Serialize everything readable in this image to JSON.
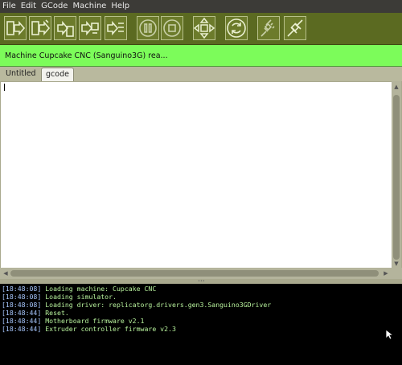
{
  "menu": {
    "items": [
      "File",
      "Edit",
      "GCode",
      "Machine",
      "Help"
    ]
  },
  "toolbar": {
    "buttons": [
      {
        "name": "build-button-icon"
      },
      {
        "name": "upload-button-icon"
      },
      {
        "name": "build-to-file-button-icon"
      },
      {
        "name": "build-remote-button-icon"
      },
      {
        "name": "generate-button-icon"
      },
      {
        "name": "pause-button-icon"
      },
      {
        "name": "stop-button-icon"
      },
      {
        "name": "control-panel-button-icon"
      },
      {
        "name": "reset-button-icon"
      },
      {
        "name": "disconnect-button-icon"
      },
      {
        "name": "connect-button-icon"
      }
    ]
  },
  "status": {
    "text": "Machine Cupcake CNC (Sanguino3G) rea..."
  },
  "tabs": [
    {
      "label": "Untitled",
      "active": false
    },
    {
      "label": "gcode",
      "active": true
    }
  ],
  "console": {
    "lines": [
      {
        "time": "[18:48:08]",
        "text": "Loading machine: Cupcake CNC"
      },
      {
        "time": "[18:48:08]",
        "text": "Loading simulator."
      },
      {
        "time": "[18:48:08]",
        "text": "Loading driver: replicatorg.drivers.gen3.Sanguino3GDriver"
      },
      {
        "time": "[18:48:44]",
        "text": "Reset."
      },
      {
        "time": "[18:48:44]",
        "text": "Motherboard firmware v2.1"
      },
      {
        "time": "[18:48:44]",
        "text": "Extruder controller firmware v2.3"
      }
    ]
  },
  "colors": {
    "toolbar_bg": "#5b6a21",
    "status_bg": "#7cfc5a",
    "console_timestamp": "#a8c8ff",
    "console_text": "#b6f09b"
  }
}
